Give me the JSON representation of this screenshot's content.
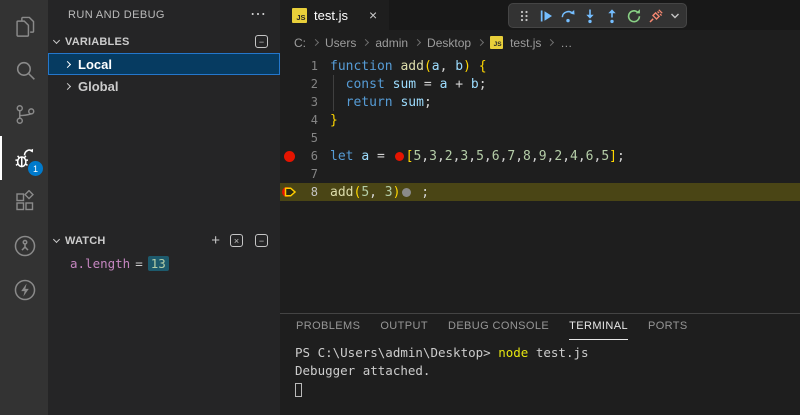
{
  "colors": {
    "accent_blue": "#007acc",
    "breakpoint_red": "#e51400",
    "current_line_highlight": "#4a4515",
    "selection_bg": "#063b61",
    "selection_border": "#2477cc",
    "toolbar_blue": "#75beff",
    "toolbar_green": "#89d185",
    "toolbar_red": "#f48771",
    "js_icon_yellow": "#e8cf3a",
    "watch_value_bg": "#1d5a6c"
  },
  "activity_bar": {
    "debug_badge": "1",
    "icons": [
      "files-explorer-icon",
      "search-icon",
      "source-control-icon",
      "run-and-debug-icon",
      "extensions-icon",
      "circle-branch-icon",
      "lightning-circle-icon"
    ]
  },
  "sidebar": {
    "title": "RUN AND DEBUG",
    "more_icon": "⋯",
    "variables": {
      "label": "VARIABLES",
      "collapse_icon": "−",
      "items": [
        {
          "label": "Local",
          "selected": true
        },
        {
          "label": "Global",
          "selected": false
        }
      ]
    },
    "watch": {
      "label": "WATCH",
      "add_icon": "+",
      "close_all_icon": "×",
      "collapse_icon": "−",
      "expression": "a.length",
      "equals": "=",
      "value": "13"
    }
  },
  "editor": {
    "tab": {
      "label": "test.js",
      "icon_text": "JS",
      "close_icon": "×"
    },
    "toolbar_buttons": [
      "drag-handle",
      "continue",
      "step-over",
      "step-into",
      "step-out",
      "restart",
      "disconnect",
      "more-chevron"
    ],
    "breadcrumb": {
      "items": [
        {
          "label": "C:"
        },
        {
          "label": "Users"
        },
        {
          "label": "admin"
        },
        {
          "label": "Desktop"
        },
        {
          "label": "test.js",
          "icon": true
        },
        {
          "label": "…"
        }
      ]
    },
    "code_lines": [
      {
        "num": "1",
        "tokens": [
          {
            "t": "function",
            "c": "kw"
          },
          {
            "t": " ",
            "c": "pl"
          },
          {
            "t": "add",
            "c": "fn"
          },
          {
            "t": "(",
            "c": "br"
          },
          {
            "t": "a",
            "c": "var"
          },
          {
            "t": ", ",
            "c": "pl"
          },
          {
            "t": "b",
            "c": "var"
          },
          {
            "t": ")",
            "c": "br"
          },
          {
            "t": " ",
            "c": "pl"
          },
          {
            "t": "{",
            "c": "br"
          }
        ]
      },
      {
        "num": "2",
        "guide": true,
        "tokens": [
          {
            "t": "  ",
            "c": "pl"
          },
          {
            "t": "const",
            "c": "kw"
          },
          {
            "t": " ",
            "c": "pl"
          },
          {
            "t": "sum",
            "c": "var"
          },
          {
            "t": " = ",
            "c": "pl"
          },
          {
            "t": "a",
            "c": "var"
          },
          {
            "t": " + ",
            "c": "pl"
          },
          {
            "t": "b",
            "c": "var"
          },
          {
            "t": ";",
            "c": "pl"
          }
        ]
      },
      {
        "num": "3",
        "guide": true,
        "tokens": [
          {
            "t": "  ",
            "c": "pl"
          },
          {
            "t": "return",
            "c": "kw"
          },
          {
            "t": " ",
            "c": "pl"
          },
          {
            "t": "sum",
            "c": "var"
          },
          {
            "t": ";",
            "c": "pl"
          }
        ]
      },
      {
        "num": "4",
        "tokens": [
          {
            "t": "}",
            "c": "br"
          }
        ]
      },
      {
        "num": "5",
        "tokens": []
      },
      {
        "num": "6",
        "breakpoint": "dot",
        "tokens": [
          {
            "t": "let",
            "c": "kw"
          },
          {
            "t": " ",
            "c": "pl"
          },
          {
            "t": "a",
            "c": "var"
          },
          {
            "t": " = ",
            "c": "pl"
          },
          {
            "c": "rdot"
          },
          {
            "t": "[",
            "c": "br"
          },
          {
            "t": "5",
            "c": "num"
          },
          {
            "t": ",",
            "c": "pl"
          },
          {
            "t": "3",
            "c": "num"
          },
          {
            "t": ",",
            "c": "pl"
          },
          {
            "t": "2",
            "c": "num"
          },
          {
            "t": ",",
            "c": "pl"
          },
          {
            "t": "3",
            "c": "num"
          },
          {
            "t": ",",
            "c": "pl"
          },
          {
            "t": "5",
            "c": "num"
          },
          {
            "t": ",",
            "c": "pl"
          },
          {
            "t": "6",
            "c": "num"
          },
          {
            "t": ",",
            "c": "pl"
          },
          {
            "t": "7",
            "c": "num"
          },
          {
            "t": ",",
            "c": "pl"
          },
          {
            "t": "8",
            "c": "num"
          },
          {
            "t": ",",
            "c": "pl"
          },
          {
            "t": "9",
            "c": "num"
          },
          {
            "t": ",",
            "c": "pl"
          },
          {
            "t": "2",
            "c": "num"
          },
          {
            "t": ",",
            "c": "pl"
          },
          {
            "t": "4",
            "c": "num"
          },
          {
            "t": ",",
            "c": "pl"
          },
          {
            "t": "6",
            "c": "num"
          },
          {
            "t": ",",
            "c": "pl"
          },
          {
            "t": "5",
            "c": "num"
          },
          {
            "t": "]",
            "c": "br"
          },
          {
            "t": ";",
            "c": "pl"
          }
        ]
      },
      {
        "num": "7",
        "tokens": []
      },
      {
        "num": "8",
        "breakpoint": "arrow",
        "current": true,
        "tokens": [
          {
            "t": "add",
            "c": "fn"
          },
          {
            "t": "(",
            "c": "br"
          },
          {
            "t": "5",
            "c": "num"
          },
          {
            "t": ", ",
            "c": "pl"
          },
          {
            "t": "3",
            "c": "num"
          },
          {
            "t": ")",
            "c": "br"
          },
          {
            "c": "gdot"
          },
          {
            "t": " ;",
            "c": "pl"
          }
        ]
      }
    ]
  },
  "panel": {
    "tabs": [
      {
        "label": "PROBLEMS",
        "active": false
      },
      {
        "label": "OUTPUT",
        "active": false
      },
      {
        "label": "DEBUG CONSOLE",
        "active": false
      },
      {
        "label": "TERMINAL",
        "active": true
      },
      {
        "label": "PORTS",
        "active": false
      }
    ],
    "terminal_lines": [
      {
        "segments": [
          {
            "t": "PS C:\\Users\\admin\\Desktop> ",
            "c": "fg"
          },
          {
            "t": "node",
            "c": "yellow"
          },
          {
            "t": " test.js",
            "c": "fg"
          }
        ]
      },
      {
        "segments": [
          {
            "t": "Debugger attached.",
            "c": "fg"
          }
        ]
      },
      {
        "cursor": true,
        "segments": []
      }
    ]
  }
}
